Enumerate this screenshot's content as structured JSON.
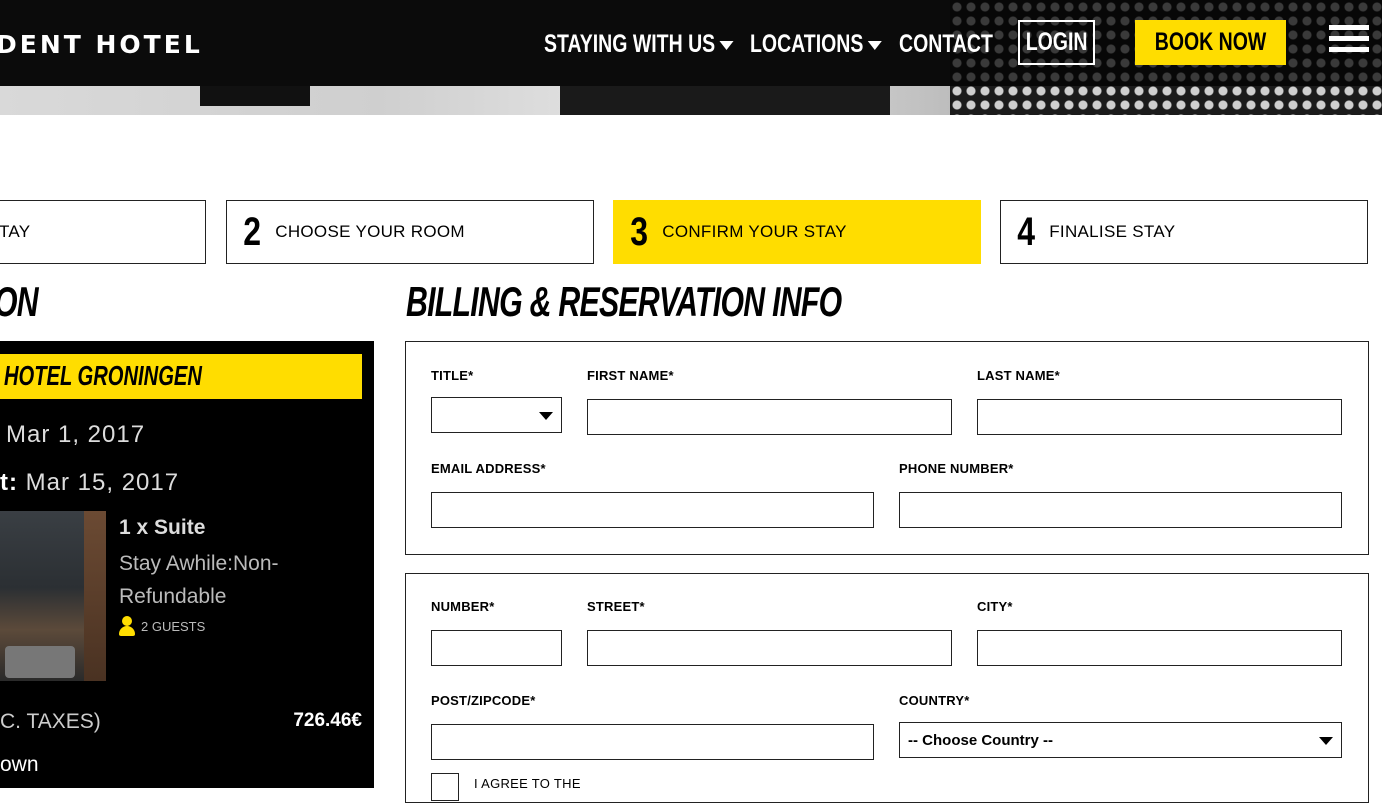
{
  "header": {
    "logo": "DENT HOTEL",
    "nav": {
      "staying": "STAYING WITH US",
      "locations": "LOCATIONS",
      "contact": "CONTACT",
      "login": "LOGIN",
      "book_now": "BOOK NOW"
    }
  },
  "steps": [
    {
      "num": "",
      "label": "TAY"
    },
    {
      "num": "2",
      "label": "CHOOSE YOUR ROOM"
    },
    {
      "num": "3",
      "label": "CONFIRM YOUR STAY"
    },
    {
      "num": "4",
      "label": "FINALISE STAY"
    }
  ],
  "summary": {
    "title": "ON",
    "hotel": "HOTEL GRONINGEN",
    "check_in": "Mar 1, 2017",
    "check_out_prefix": "t:",
    "check_out": "Mar 15, 2017",
    "room_title": "1 x Suite",
    "room_rate": "Stay Awhile:Non-Refundable",
    "guests": "2 GUESTS",
    "taxes_label": "C. TAXES)",
    "total": "726.46€",
    "breakdown": "own"
  },
  "billing": {
    "title": "BILLING & RESERVATION INFO",
    "labels": {
      "title": "TITLE*",
      "first_name": "FIRST NAME*",
      "last_name": "LAST NAME*",
      "email": "EMAIL ADDRESS*",
      "phone": "PHONE NUMBER*",
      "number": "NUMBER*",
      "street": "STREET*",
      "city": "CITY*",
      "zip": "POST/ZIPCODE*",
      "country": "COUNTRY*"
    },
    "title_value": "",
    "country_value": "-- Choose Country --",
    "agree": "I AGREE TO THE"
  },
  "colors": {
    "accent": "#ffdd00",
    "dark": "#000000"
  }
}
